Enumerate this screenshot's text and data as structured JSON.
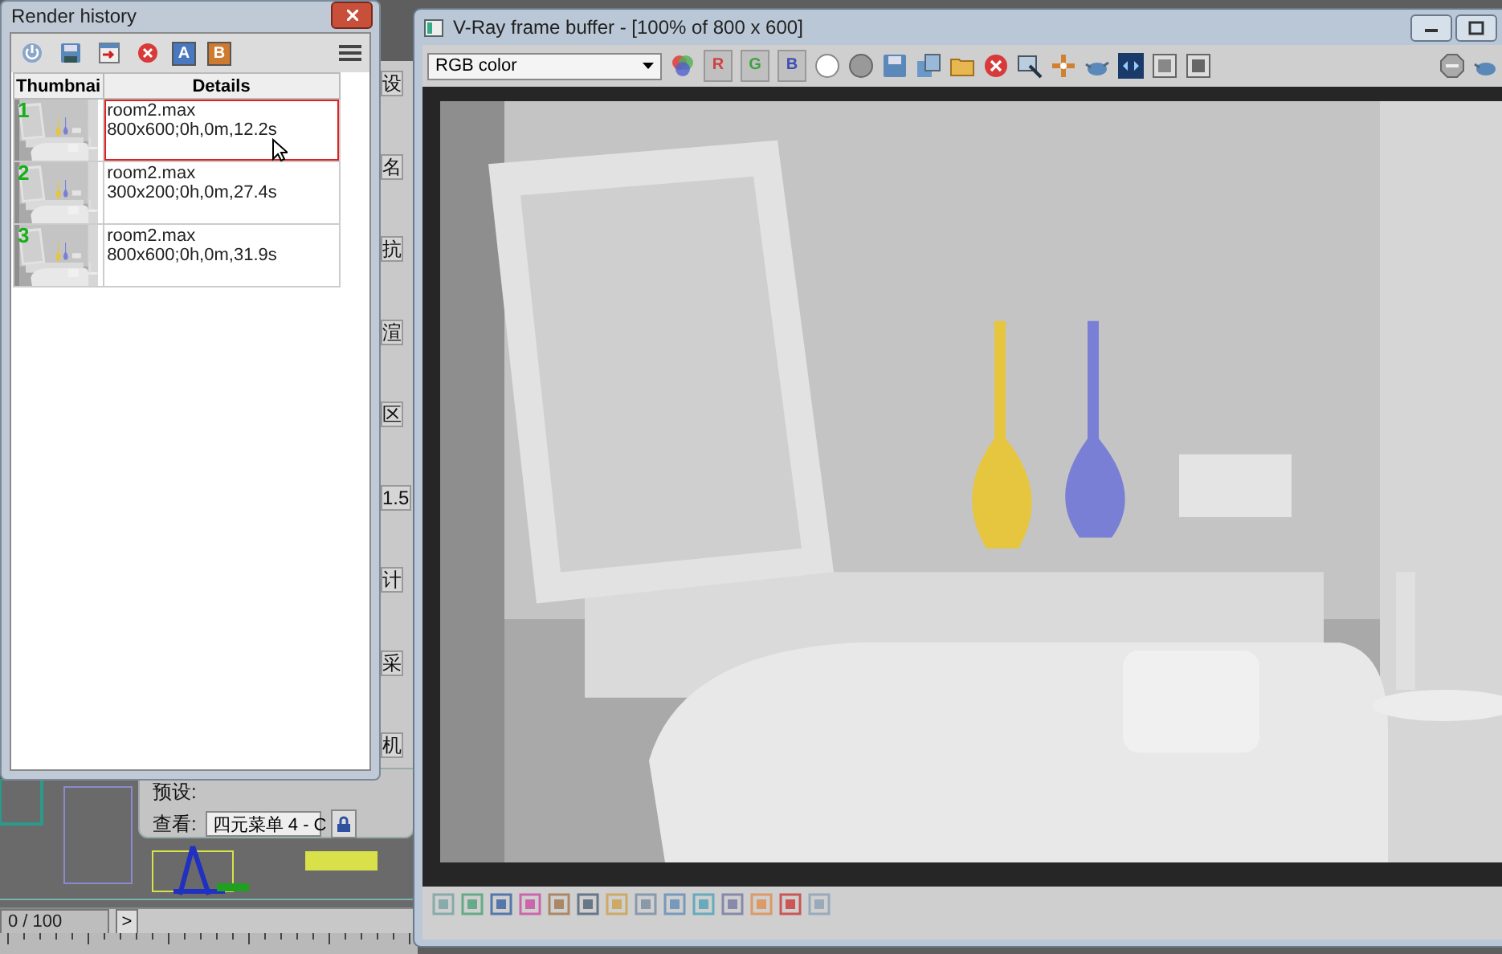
{
  "side_panel": {
    "labels": [
      "设",
      "名",
      "抗",
      "渲",
      "区",
      "1.5",
      "计",
      "采",
      "机"
    ]
  },
  "render_setup": {
    "preset_label": "预设:",
    "view_label": "查看:",
    "view_value": "四元菜单 4 - C"
  },
  "time_slider": {
    "frame": "0 / 100",
    "next": ">"
  },
  "render_history": {
    "title": "Render history",
    "compare_buttons": [
      "A",
      "B"
    ],
    "columns": [
      "Thumbnai",
      "Details"
    ],
    "rows": [
      {
        "number": "1",
        "file": "room2.max",
        "info": "800x600;0h,0m,12.2s",
        "selected": true
      },
      {
        "number": "2",
        "file": "room2.max",
        "info": "300x200;0h,0m,27.4s",
        "selected": false
      },
      {
        "number": "3",
        "file": "room2.max",
        "info": "800x600;0h,0m,31.9s",
        "selected": false
      }
    ]
  },
  "frame_buffer": {
    "title": "V-Ray frame buffer - [100% of 800 x 600]",
    "channel": "RGB color",
    "channel_buttons": [
      {
        "label": "R",
        "on": true,
        "color": "#d04040"
      },
      {
        "label": "G",
        "on": true,
        "color": "#40a040"
      },
      {
        "label": "B",
        "on": true,
        "color": "#4050b0"
      }
    ]
  }
}
